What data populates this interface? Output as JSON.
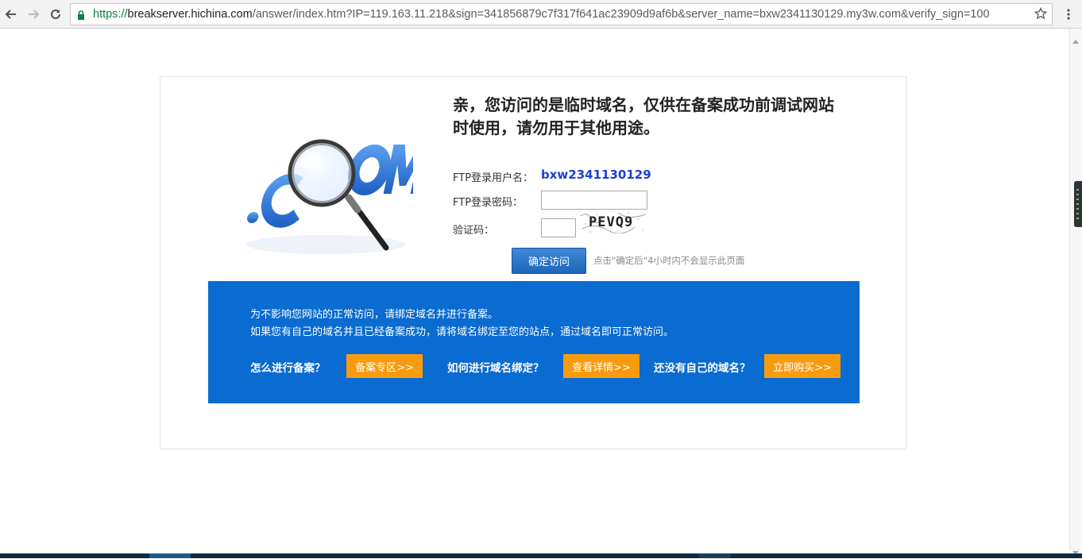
{
  "browser": {
    "url_scheme": "https://",
    "url_host": "breakserver.hichina.com",
    "url_rest": "/answer/index.htm?IP=119.163.11.218&sign=341856879c7f317f641ac23909d9af6b&server_name=bxw2341130129.my3w.com&verify_sign=100",
    "icons": [
      "back-icon",
      "forward-icon",
      "reload-icon",
      "lock-icon",
      "star-icon",
      "menu-icon"
    ]
  },
  "notice": {
    "headline_line1": "亲，您访问的是临时域名，仅供在备案成功前调试网站",
    "headline_line2": "时使用，请勿用于其他用途。",
    "logo_text": ".COM"
  },
  "form": {
    "ftp_user_label": "FTP登录用户名：",
    "ftp_user_value": "bxw2341130129",
    "ftp_password_label": "FTP登录密码：",
    "captcha_label": "验证码：",
    "captcha_text": "PEVQ9",
    "confirm_button": "确定访问",
    "hint": "点击\"确定后\"4小时内不会显示此页面"
  },
  "panel": {
    "line1": "为不影响您网站的正常访问，请绑定域名并进行备案。",
    "line2": "如果您有自己的域名并且已经备案成功，请将域名绑定至您的站点，通过域名即可正常访问。",
    "q1": "怎么进行备案？",
    "b1": "备案专区>>",
    "q2": "如何进行域名绑定？",
    "b2": "查看详情>>",
    "q3": "还没有自己的域名？",
    "b3": "立即购买>>"
  },
  "colors": {
    "panel_blue": "#0a6bd1",
    "orange": "#f99b0f",
    "username_blue": "#1a3fd6"
  }
}
